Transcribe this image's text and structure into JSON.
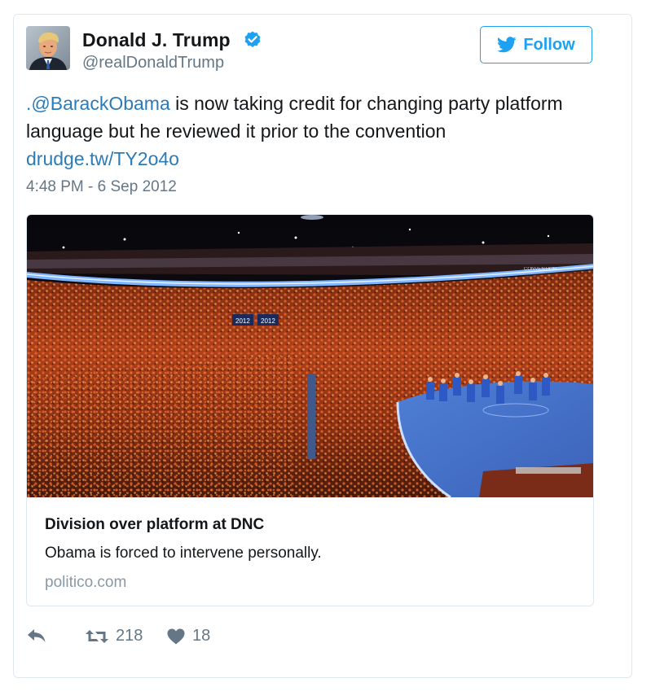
{
  "tweet": {
    "author_name": "Donald J. Trump",
    "handle": "@realDonaldTrump",
    "follow_label": "Follow",
    "text": {
      "mention": ".@BarackObama",
      "body_line": " is now taking credit for changing party platform language but he reviewed it prior to the convention",
      "link": "drudge.tw/TY2o4o"
    },
    "timestamp": "4:48 PM - 6 Sep 2012",
    "link_card": {
      "title": "Division over platform at DNC",
      "description": "Obama is forced to intervene personally.",
      "domain": "politico.com",
      "photo_signs": [
        "2012",
        "2012"
      ],
      "banner_text": "CONVENTION"
    },
    "actions": {
      "retweets": "218",
      "likes": "18"
    }
  },
  "colors": {
    "link_blue": "#2b7bb9",
    "twitter_blue": "#1da1f2",
    "muted_gray": "#657786",
    "domain_gray": "#8899a6",
    "border": "#e1e8ed"
  },
  "icons": {
    "verified": "verified-badge-icon",
    "follow": "twitter-bird-icon",
    "reply": "reply-arrow-icon",
    "retweet": "retweet-icon",
    "like": "heart-icon"
  }
}
